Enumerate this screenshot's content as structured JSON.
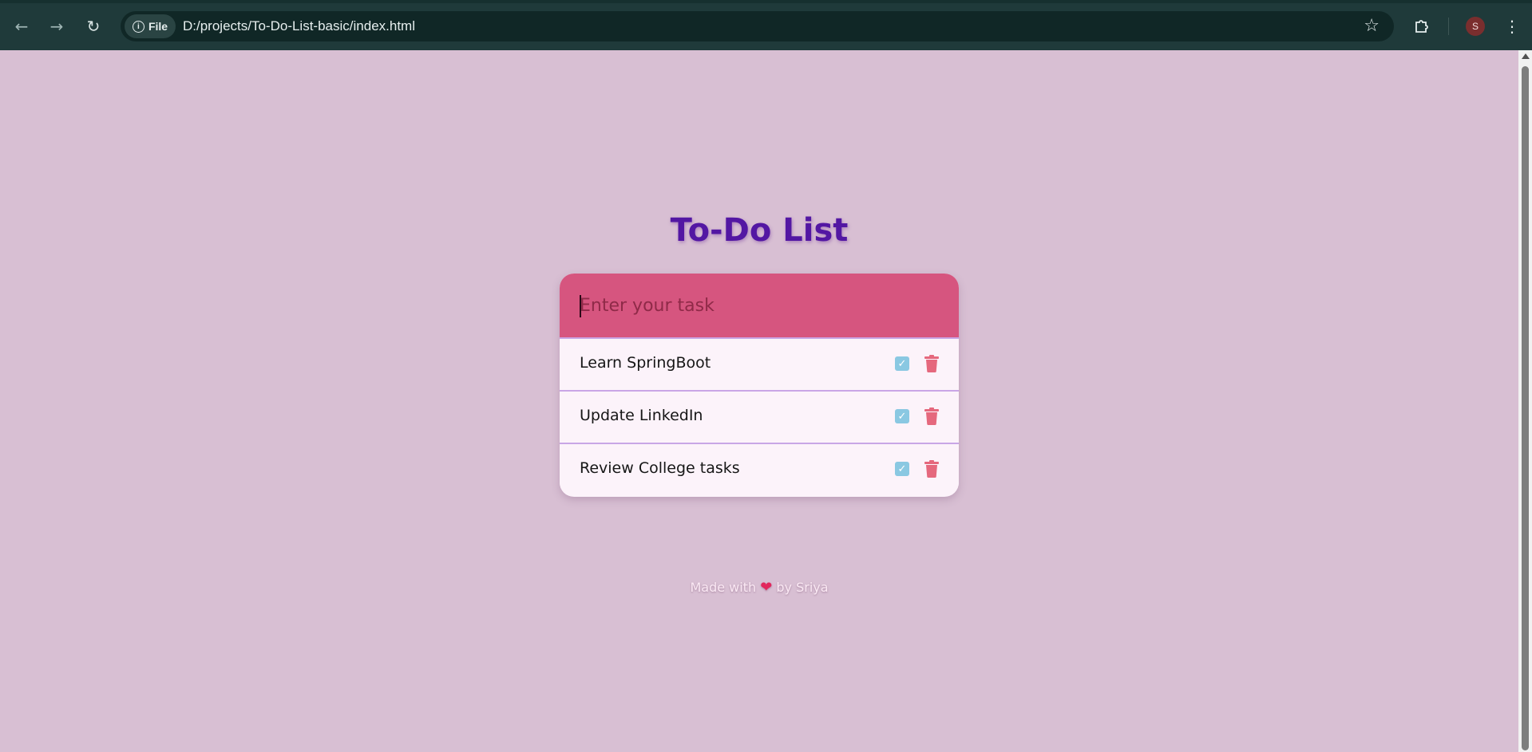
{
  "browser": {
    "file_chip_label": "File",
    "url": "D:/projects/To-Do-List-basic/index.html",
    "profile_initial": "S"
  },
  "icons": {
    "back": "back-arrow-icon",
    "forward": "forward-arrow-icon",
    "reload": "reload-icon",
    "info": "info-icon",
    "bookmark": "star-icon",
    "extensions": "puzzle-icon",
    "menu": "kebab-menu-icon",
    "complete": "checkbox-icon",
    "delete": "trash-icon",
    "heart": "heart-icon"
  },
  "app": {
    "title": "To-Do List",
    "input_placeholder": "Enter your task",
    "input_value": "",
    "tasks": [
      {
        "text": "Learn SpringBoot"
      },
      {
        "text": "Update LinkedIn"
      },
      {
        "text": "Review College tasks"
      }
    ],
    "footer": {
      "before": "Made with",
      "heart": "❤",
      "after": "by Sriya"
    }
  },
  "colors": {
    "page_background": "#d8bfd3",
    "title": "#5317a3",
    "input_background": "#d6557f",
    "list_background": "#fcf3fa",
    "divider": "#c9a6e6",
    "check": "#8ac8e2",
    "trash": "#e5687d"
  }
}
